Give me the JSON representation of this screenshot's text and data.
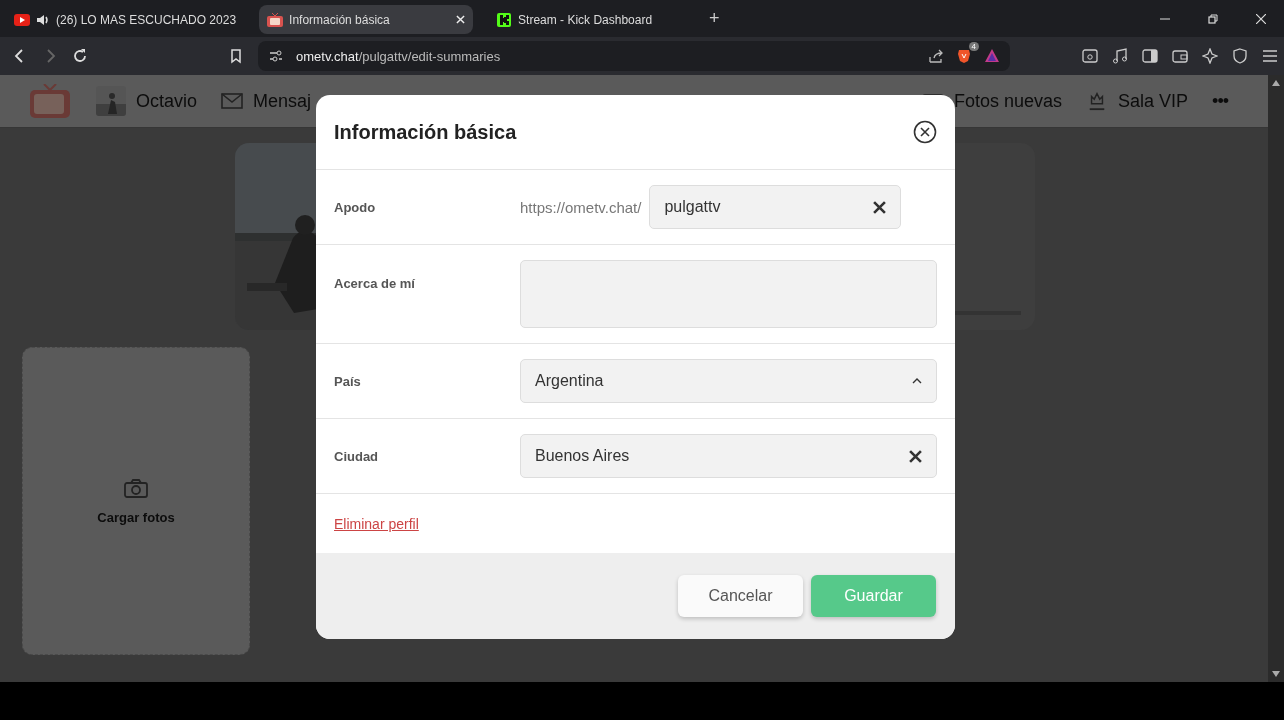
{
  "browser": {
    "tabs": [
      {
        "kind": "video",
        "title": "(26) LO MAS ESCUCHADO 2023",
        "audio": true,
        "selected": false
      },
      {
        "kind": "tv",
        "title": "Información básica",
        "audio": false,
        "selected": true
      },
      {
        "kind": "kick",
        "title": "Stream - Kick Dashboard",
        "audio": false,
        "selected": false
      }
    ],
    "new_tab": "+",
    "url": {
      "host": "ometv.chat",
      "path": "/pulgattv/edit-summaries"
    },
    "shields_count": "4"
  },
  "nav": {
    "user": "Octavio",
    "items": [
      "Mensaj",
      "Fotos nuevas",
      "Sala VIP"
    ],
    "more": "•••"
  },
  "upload": {
    "label": "Cargar fotos"
  },
  "dialog": {
    "title": "Información básica",
    "fields": [
      {
        "kind": "prefixed",
        "label": "Apodo",
        "prefix": "https://ometv.chat/",
        "value": "pulgattv"
      },
      {
        "kind": "textarea",
        "label": "Acerca de mí"
      },
      {
        "kind": "select",
        "label": "País",
        "value": "Argentina"
      },
      {
        "kind": "clearable",
        "label": "Ciudad",
        "value": "Buenos Aires"
      }
    ],
    "delete_link": "Eliminar perfil",
    "buttons": [
      {
        "kind": "secondary",
        "label": "Cancelar"
      },
      {
        "kind": "primary",
        "label": "Guardar"
      }
    ]
  }
}
